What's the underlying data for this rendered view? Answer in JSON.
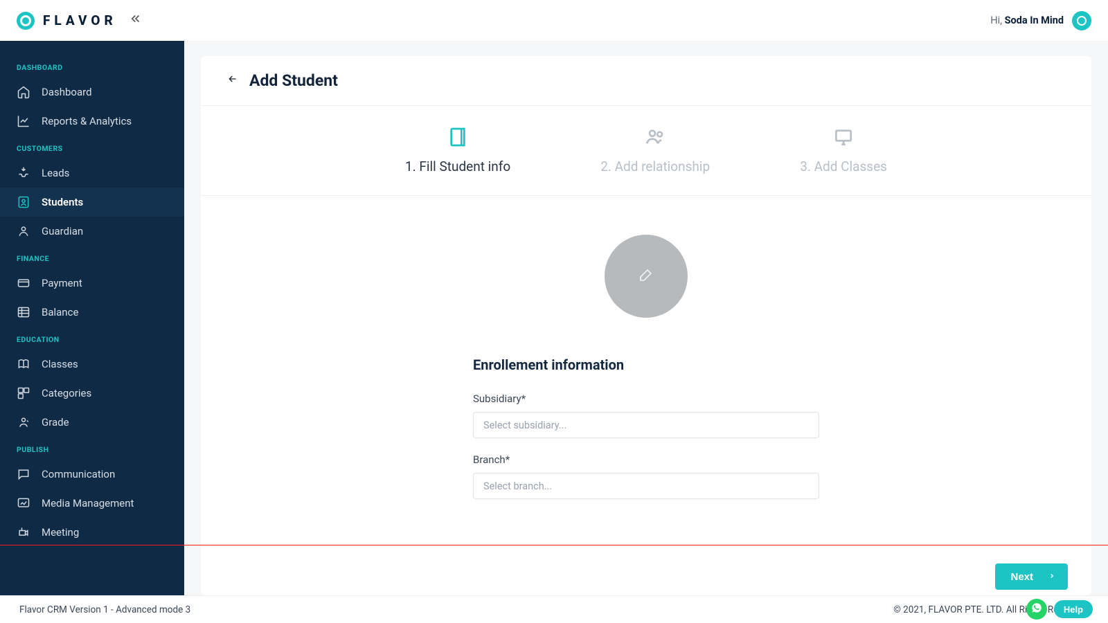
{
  "brand": "FLAVOR",
  "header": {
    "greeting_prefix": "Hi, ",
    "user_name": "Soda In Mind"
  },
  "sidebar": {
    "sections": [
      {
        "title": "DASHBOARD",
        "items": [
          {
            "icon": "home-icon",
            "label": "Dashboard"
          },
          {
            "icon": "analytics-icon",
            "label": "Reports & Analytics"
          }
        ]
      },
      {
        "title": "CUSTOMERS",
        "items": [
          {
            "icon": "leads-icon",
            "label": "Leads"
          },
          {
            "icon": "students-icon",
            "label": "Students",
            "active": true
          },
          {
            "icon": "guardian-icon",
            "label": "Guardian"
          }
        ]
      },
      {
        "title": "FINANCE",
        "items": [
          {
            "icon": "payment-icon",
            "label": "Payment"
          },
          {
            "icon": "balance-icon",
            "label": "Balance"
          }
        ]
      },
      {
        "title": "EDUCATION",
        "items": [
          {
            "icon": "classes-icon",
            "label": "Classes"
          },
          {
            "icon": "categories-icon",
            "label": "Categories"
          },
          {
            "icon": "grade-icon",
            "label": "Grade"
          }
        ]
      },
      {
        "title": "PUBLISH",
        "items": [
          {
            "icon": "communication-icon",
            "label": "Communication"
          },
          {
            "icon": "media-icon",
            "label": "Media Management"
          },
          {
            "icon": "meeting-icon",
            "label": "Meeting"
          }
        ]
      }
    ]
  },
  "page": {
    "title": "Add Student",
    "steps": [
      {
        "label": "1. Fill Student info",
        "active": true
      },
      {
        "label": "2. Add relationship",
        "active": false
      },
      {
        "label": "3. Add Classes",
        "active": false
      }
    ],
    "form": {
      "section_title": "Enrollement information",
      "fields": [
        {
          "label": "Subsidiary*",
          "placeholder": "Select subsidiary..."
        },
        {
          "label": "Branch*",
          "placeholder": "Select branch..."
        }
      ]
    },
    "next_label": "Next"
  },
  "footer": {
    "left": "Flavor CRM Version 1 - Advanced mode 3",
    "right": "© 2021, FLAVOR PTE. LTD. All Rights Reserved."
  },
  "help_label": "Help"
}
